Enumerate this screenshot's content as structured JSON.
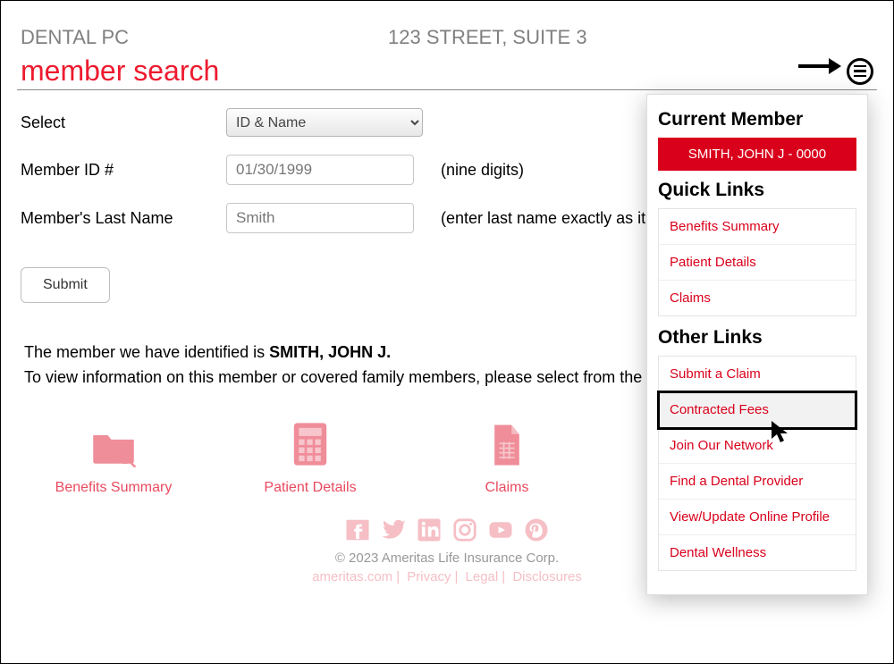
{
  "header": {
    "practice": "DENTAL PC",
    "address": "123 STREET, SUITE 3"
  },
  "title": "member search",
  "form": {
    "select": {
      "label": "Select",
      "value": "ID & Name"
    },
    "member_id": {
      "label": "Member ID #",
      "value": "01/30/1999",
      "hint": "(nine digits)"
    },
    "last_name": {
      "label": "Member's Last Name",
      "value": "Smith",
      "hint": "(enter last name exactly as it a"
    },
    "submit": "Submit"
  },
  "result": {
    "line1_prefix": "The member we have identified is ",
    "line1_name": "SMITH, JOHN J.",
    "line2": "To view information on this member or covered family members, please select from the options be"
  },
  "cards": {
    "benefits": "Benefits Summary",
    "patient": "Patient Details",
    "claims": "Claims"
  },
  "footer": {
    "copyright": "© 2023 Ameritas Life Insurance Corp.",
    "links": [
      "ameritas.com",
      "Privacy",
      "Legal",
      "Disclosures"
    ]
  },
  "panel": {
    "current_member_h": "Current Member",
    "member_badge": "SMITH, JOHN J - 0000",
    "quick_h": "Quick Links",
    "quick": [
      "Benefits Summary",
      "Patient Details",
      "Claims"
    ],
    "other_h": "Other Links",
    "other": [
      "Submit a Claim",
      "Contracted Fees",
      "Join Our Network",
      "Find a Dental Provider",
      "View/Update Online Profile",
      "Dental Wellness"
    ]
  }
}
